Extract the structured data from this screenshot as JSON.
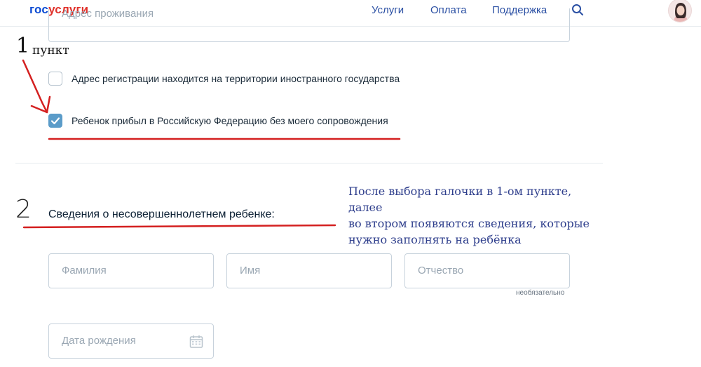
{
  "header": {
    "logo_part1": "гос",
    "logo_part2": "услуги",
    "nav": [
      "Услуги",
      "Оплата",
      "Поддержка"
    ]
  },
  "form": {
    "address_placeholder": "Адрес проживания",
    "checkbox_foreign": {
      "label": "Адрес регистрации находится на территории иностранного государства",
      "checked": false
    },
    "checkbox_unaccompanied": {
      "label": "Ребенок прибыл в Российскую Федерацию без моего сопровождения",
      "checked": true
    },
    "section_title": "Сведения о несовершеннолетнем ребенке:",
    "fields": {
      "surname": "Фамилия",
      "name": "Имя",
      "patronymic": "Отчество",
      "optional_hint": "необязательно",
      "birthdate": "Дата рождения"
    }
  },
  "annotations": {
    "step1_number": "1",
    "step1_word": "пункт",
    "step2_number": "2",
    "note_lines": [
      "После выбора галочки в 1-ом пункте, далее",
      "во втором появяются сведения, которые",
      "нужно заполнять на ребёнка"
    ],
    "ink_color": "#d42020",
    "note_color": "#2e3e8c"
  },
  "colors": {
    "brand_blue": "#0d4cd3",
    "brand_red": "#e0322b",
    "checkbox_checked": "#5b9cc9"
  }
}
